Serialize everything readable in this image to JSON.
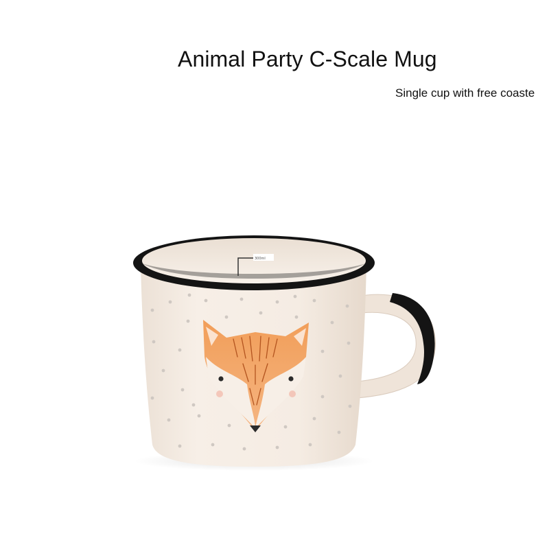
{
  "product": {
    "title": "Animal Party C-Scale Mug",
    "subtitle": "Single cup with free coaste",
    "scale_mark": "300ml"
  },
  "colors": {
    "background": "#ffffff",
    "mug_body": "#f4ebe2",
    "rim": "#161616",
    "fox_orange": "#ef9a5a",
    "dots": "#c8c2bd"
  },
  "image": {
    "subject": "mug",
    "decoration": "fox-face"
  }
}
